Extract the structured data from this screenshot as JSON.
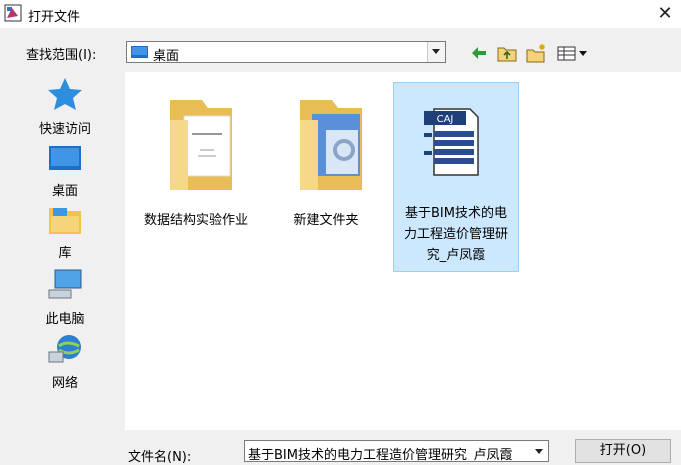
{
  "window": {
    "title": "打开文件",
    "close_glyph": "✕"
  },
  "lookin": {
    "label": "查找范围(I):",
    "value": "桌面"
  },
  "places": [
    {
      "label": "快速访问",
      "icon": "star-icon"
    },
    {
      "label": "桌面",
      "icon": "desktop-icon"
    },
    {
      "label": "库",
      "icon": "library-icon"
    },
    {
      "label": "此电脑",
      "icon": "computer-icon"
    },
    {
      "label": "网络",
      "icon": "network-icon"
    }
  ],
  "files": [
    {
      "name": "数据结构实验作业",
      "type": "folder"
    },
    {
      "name": "新建文件夹",
      "type": "folder"
    },
    {
      "name_lines": [
        "基于BIM技术的电",
        "力工程造价管理研",
        "究_卢凤霞"
      ],
      "type": "caj-document",
      "badge": "CAJ",
      "selected": true
    }
  ],
  "filename": {
    "label": "文件名(N):",
    "value": "基于BIM技术的电力工程造价管理研究_卢凤霞"
  },
  "buttons": {
    "open": "打开(O)"
  },
  "colors": {
    "selection": "#cce8ff",
    "accent": "#1e6fc8",
    "folder": "#f3d27a"
  }
}
